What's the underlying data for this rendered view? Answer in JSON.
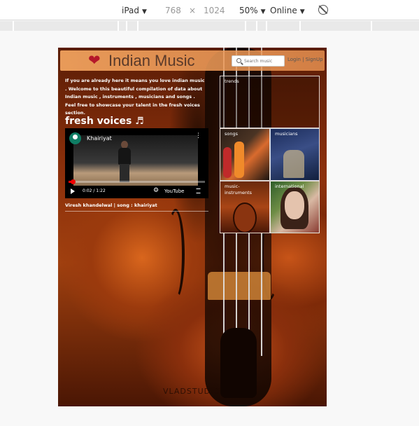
{
  "devtools": {
    "device": "iPad",
    "width": "768",
    "times": "×",
    "height": "1024",
    "zoom": "50%",
    "network": "Online"
  },
  "header": {
    "title": "Indian Music",
    "search_placeholder": "Search music",
    "auth_link": "Login | SignUp"
  },
  "intro": {
    "text": "If you are already here it means you love indian music . Welcome to this beautiful compilation of data about Indian music , instruments , musicians and songs . Feel free to showcase your talent in the fresh voices section."
  },
  "fresh_voices": {
    "title": "fresh voices ♬",
    "video": {
      "title": "Khairiyat",
      "time": "0:02 / 1:22",
      "brand": "YouTube",
      "progress": 0.03
    },
    "caption": "Viresh khandelwal | song : khairiyat"
  },
  "tiles": {
    "trends": "trends",
    "songs": "songs",
    "musicians": "musicians",
    "instruments": "music-\ninstruments",
    "international": "international"
  },
  "watermark": "VLADSTUDIO",
  "colors": {
    "header": "#f4a560",
    "accent": "#b5182a",
    "progress": "#ee0000"
  }
}
